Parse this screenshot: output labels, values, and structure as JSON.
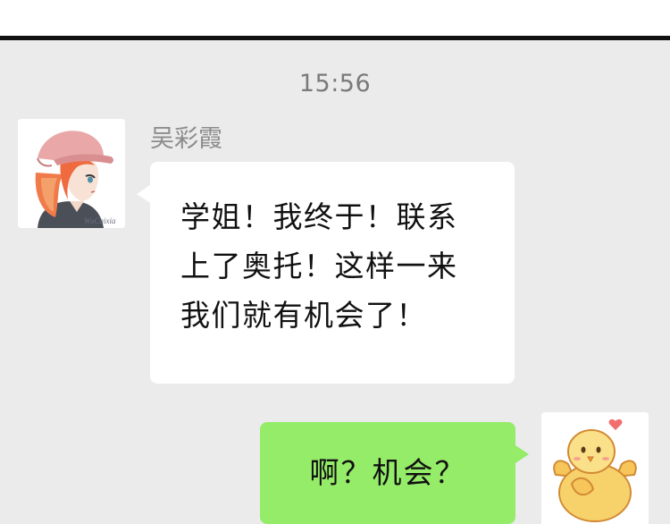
{
  "chat": {
    "timestamp": "15:56",
    "messages": [
      {
        "sender": "吴彩霞",
        "side": "left",
        "text": "学姐！我终于！联系\n上了奥托！这样一来\n我们就有机会了！",
        "avatar_icon": "girl-with-pink-cap-avatar"
      },
      {
        "side": "right",
        "text": "啊？机会？",
        "avatar_icon": "yellow-chick-avatar"
      }
    ],
    "left_avatar_watermark": "WuCaixia"
  },
  "colors": {
    "chat_background": "#ebebeb",
    "incoming_bubble": "#ffffff",
    "outgoing_bubble": "#95ec69",
    "divider": "#111111"
  }
}
